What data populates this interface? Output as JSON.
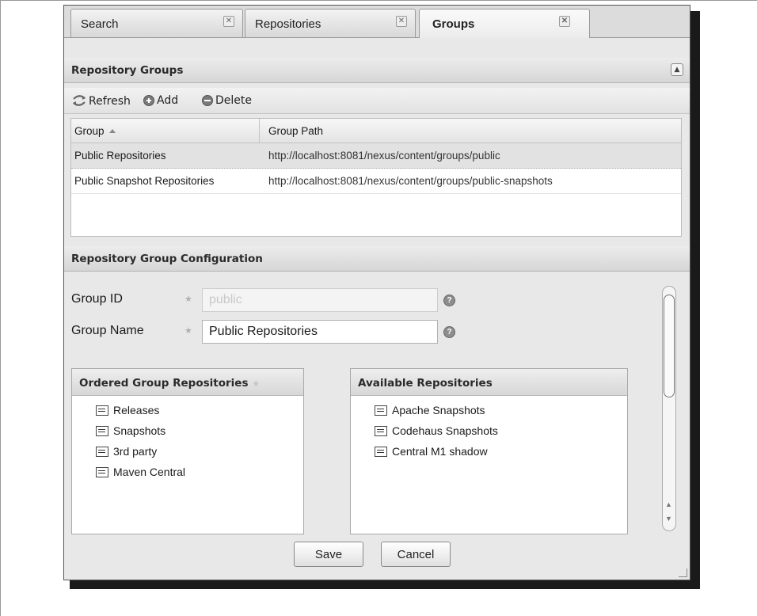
{
  "tabs": [
    {
      "label": "Search",
      "active": false
    },
    {
      "label": "Repositories",
      "active": false
    },
    {
      "label": "Groups",
      "active": true
    }
  ],
  "groups_panel": {
    "title": "Repository Groups",
    "toolbar": {
      "refresh": "Refresh",
      "add": "Add",
      "delete": "Delete"
    },
    "columns": [
      "Group",
      "Group Path"
    ],
    "rows": [
      {
        "group": "Public Repositories",
        "path": "http://localhost:8081/nexus/content/groups/public",
        "selected": true
      },
      {
        "group": "Public Snapshot Repositories",
        "path": "http://localhost:8081/nexus/content/groups/public-snapshots",
        "selected": false
      }
    ]
  },
  "config_panel": {
    "title": "Repository Group Configuration",
    "group_id_label": "Group ID",
    "group_id_value": "public",
    "group_name_label": "Group Name",
    "group_name_value": "Public Repositories",
    "ordered_title": "Ordered Group Repositories",
    "ordered_items": [
      "Releases",
      "Snapshots",
      "3rd party",
      "Maven Central"
    ],
    "available_title": "Available Repositories",
    "available_items": [
      "Apache Snapshots",
      "Codehaus Snapshots",
      "Central M1 shadow"
    ],
    "save_label": "Save",
    "cancel_label": "Cancel"
  }
}
